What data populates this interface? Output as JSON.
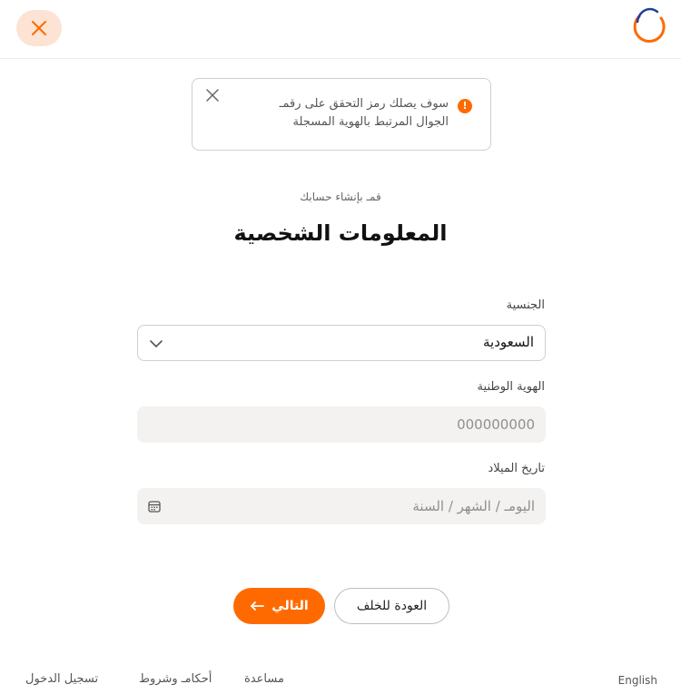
{
  "header": {
    "close_icon": "close-icon",
    "logo_icon": "brand-logo-icon"
  },
  "alert": {
    "line1": "سوف يصلك رمز التحقق على رقمـ",
    "line2": "الجوال المرتبط بالهوية المسجلة",
    "info_icon_glyph": "!",
    "info_icon": "exclamation-icon",
    "close_icon": "close-icon"
  },
  "form": {
    "subtitle": "قمـ بإنشاء حسابك",
    "title": "المعلومات الشخصية",
    "nationality": {
      "label": "الجنسية",
      "value": "السعودية",
      "icon": "chevron-down-icon"
    },
    "national_id": {
      "label": "الهوية الوطنية",
      "placeholder": "000000000"
    },
    "birth_date": {
      "label": "تاريخ الميلاد",
      "placeholder": "اليومـ / الشهر / السنة",
      "icon": "calendar-icon"
    }
  },
  "actions": {
    "next_label": "التالي",
    "next_icon": "arrow-left-icon",
    "back_label": "العودة للخلف"
  },
  "footer": {
    "login": "تسجيل الدخول",
    "terms": "أحكامـ وشروط",
    "help": "مساعدة",
    "language": "English"
  },
  "colors": {
    "accent": "#ff6a00",
    "accent_soft": "#fde3d3",
    "field_bg": "#f3f2f1",
    "logo_blue": "#1f3f9c"
  }
}
